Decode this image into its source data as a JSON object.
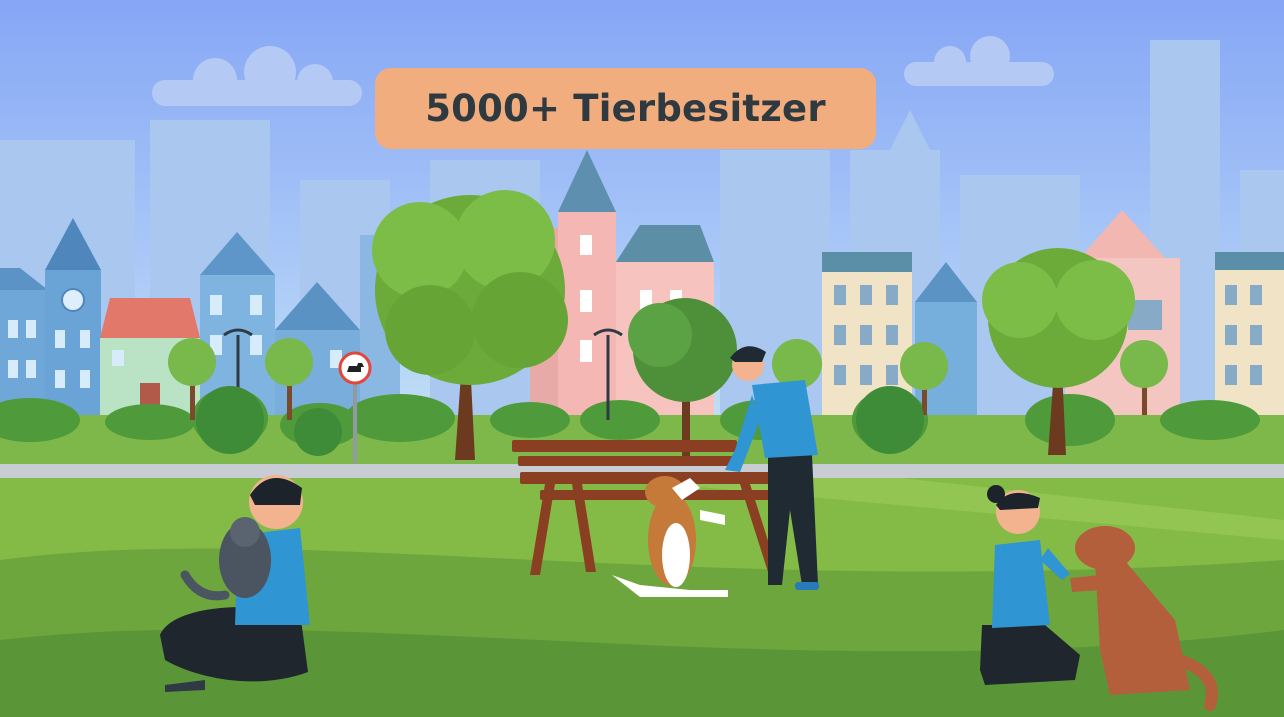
{
  "banner": {
    "text": "5000+ Tierbesitzer"
  },
  "sign": {
    "icon": "dog-icon"
  },
  "colors": {
    "sky_top": "#8aaaf6",
    "sky_bottom": "#c2e3f6",
    "banner_bg": "#f2ad7e",
    "banner_text": "#2f3a40",
    "grass_light": "#8fc24a",
    "grass_dark": "#5f9e3a",
    "path": "#c9cfd4",
    "tree": "#6fad3c",
    "bench": "#8b3f22",
    "shirt": "#2e93d1"
  }
}
